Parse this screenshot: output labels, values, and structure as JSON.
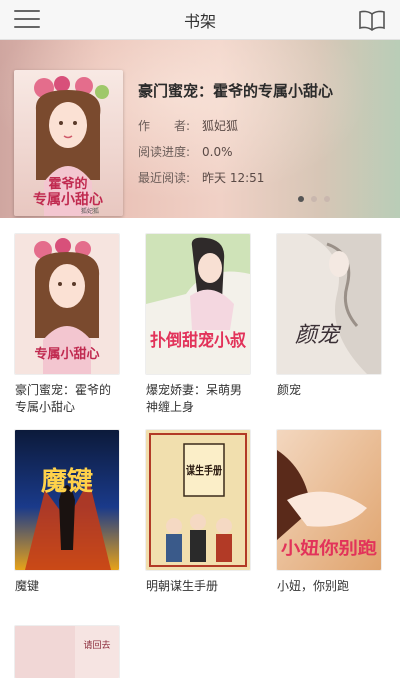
{
  "header": {
    "title": "书架",
    "left_icon": "menu-icon",
    "right_icon": "open-book-icon"
  },
  "hero": {
    "title": "豪门蜜宠：霍爷的专属小甜心",
    "author_label": "作　　者:",
    "author": "狐妃狐",
    "progress_label": "阅读进度:",
    "progress": "0.0%",
    "last_read_label": "最近阅读:",
    "last_read": "昨天 12:51",
    "cover_text_a": "霍爷的",
    "cover_text_b": "专属小甜心",
    "cover_author": "狐妃狐",
    "carousel_active": 0,
    "carousel_count": 3
  },
  "books": [
    {
      "name": "豪门蜜宠：霍爷的专属小甜心",
      "cover_text": "专属小甜心"
    },
    {
      "name": "爆宠娇妻：呆萌男神缠上身",
      "cover_text": "扑倒甜宠小叔"
    },
    {
      "name": "颜宠",
      "cover_text": "颜宠"
    },
    {
      "name": "魔键",
      "cover_text": "魔键"
    },
    {
      "name": "明朝谋生手册",
      "cover_text": "谋生手册"
    },
    {
      "name": "小妞，你别跑",
      "cover_text": "小妞你别跑"
    },
    {
      "name": "",
      "cover_text": "请回去"
    }
  ],
  "colors": {
    "accent": "#e2335a",
    "header_bg": "#f7f7f7",
    "text": "#333333"
  }
}
